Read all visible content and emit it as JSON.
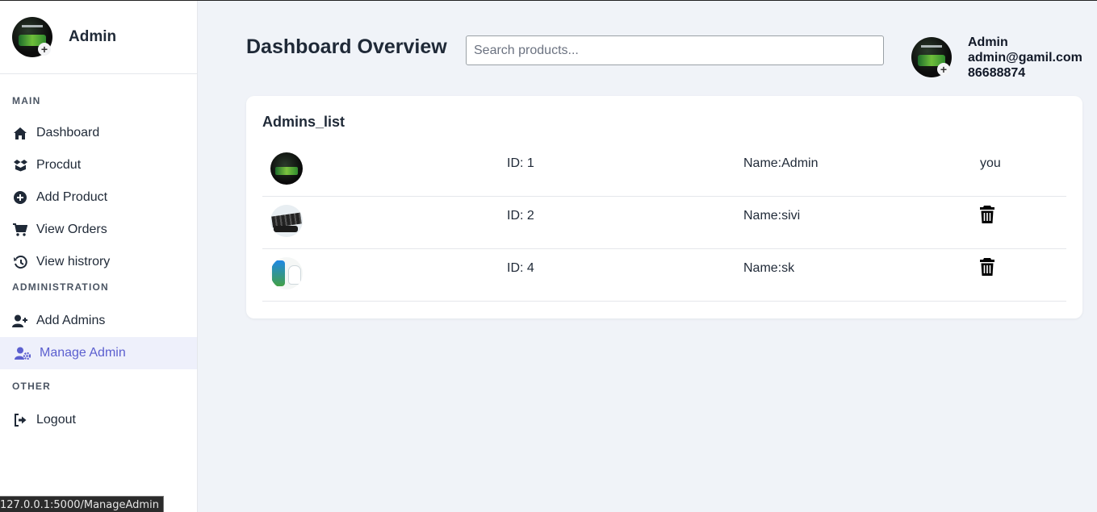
{
  "sidebar": {
    "title": "Admin",
    "sections": {
      "main": "MAIN",
      "administration": "ADMINISTRATION",
      "other": "OTHER"
    },
    "items": {
      "dashboard": "Dashboard",
      "product": "Procdut",
      "add_product": "Add Product",
      "view_orders": "View Orders",
      "view_history": "View histrory",
      "add_admins": "Add Admins",
      "manage_admin": "Manage Admin",
      "logout": "Logout"
    },
    "active_item": "manage_admin",
    "accent_color": "#5b5fcf"
  },
  "header": {
    "title": "Dashboard Overview",
    "search_placeholder": "Search products...",
    "search_value": "",
    "profile": {
      "name": "Admin",
      "email": "admin@gamil.com",
      "phone": "86688874"
    }
  },
  "card": {
    "title": "Admins_list",
    "rows": [
      {
        "id": "ID: 1",
        "name": "Name:Admin",
        "action": "you",
        "thumb": "admin-avatar"
      },
      {
        "id": "ID: 2",
        "name": "Name:sivi",
        "action": "delete",
        "thumb": "keyboard-product"
      },
      {
        "id": "ID: 4",
        "name": "Name:sk",
        "action": "delete",
        "thumb": "bulb-product"
      }
    ]
  },
  "status_bar": {
    "url": "127.0.0.1:5000/ManageAdmin"
  }
}
